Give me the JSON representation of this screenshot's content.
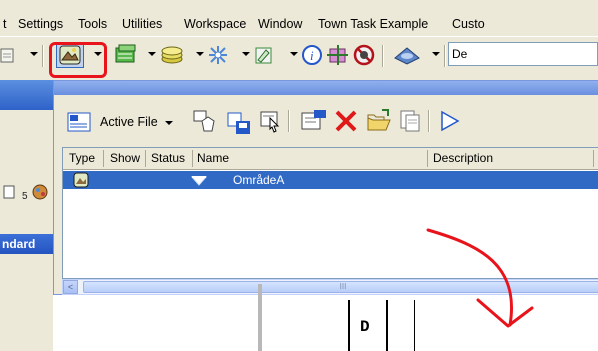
{
  "menu": {
    "items": [
      "t",
      "Settings",
      "Tools",
      "Utilities",
      "Workspace",
      "Window",
      "Town Task Example",
      "Custo"
    ]
  },
  "toolbar": {
    "combo_value": "De"
  },
  "dialog": {
    "active_file_label": "Active File",
    "columns": [
      "Type",
      "Show",
      "Status",
      "Name",
      "Description"
    ],
    "rows": [
      {
        "name": "OmrådeA"
      }
    ],
    "scroll_thumb_grip": "III"
  },
  "left_panel": {
    "label": "ndard",
    "glyph": "⬌"
  },
  "canvas": {
    "cell_letter": "D"
  },
  "colors": {
    "highlight": "#e8131b",
    "selection": "#316ac5",
    "annotation_arrow": "#e8131b"
  }
}
